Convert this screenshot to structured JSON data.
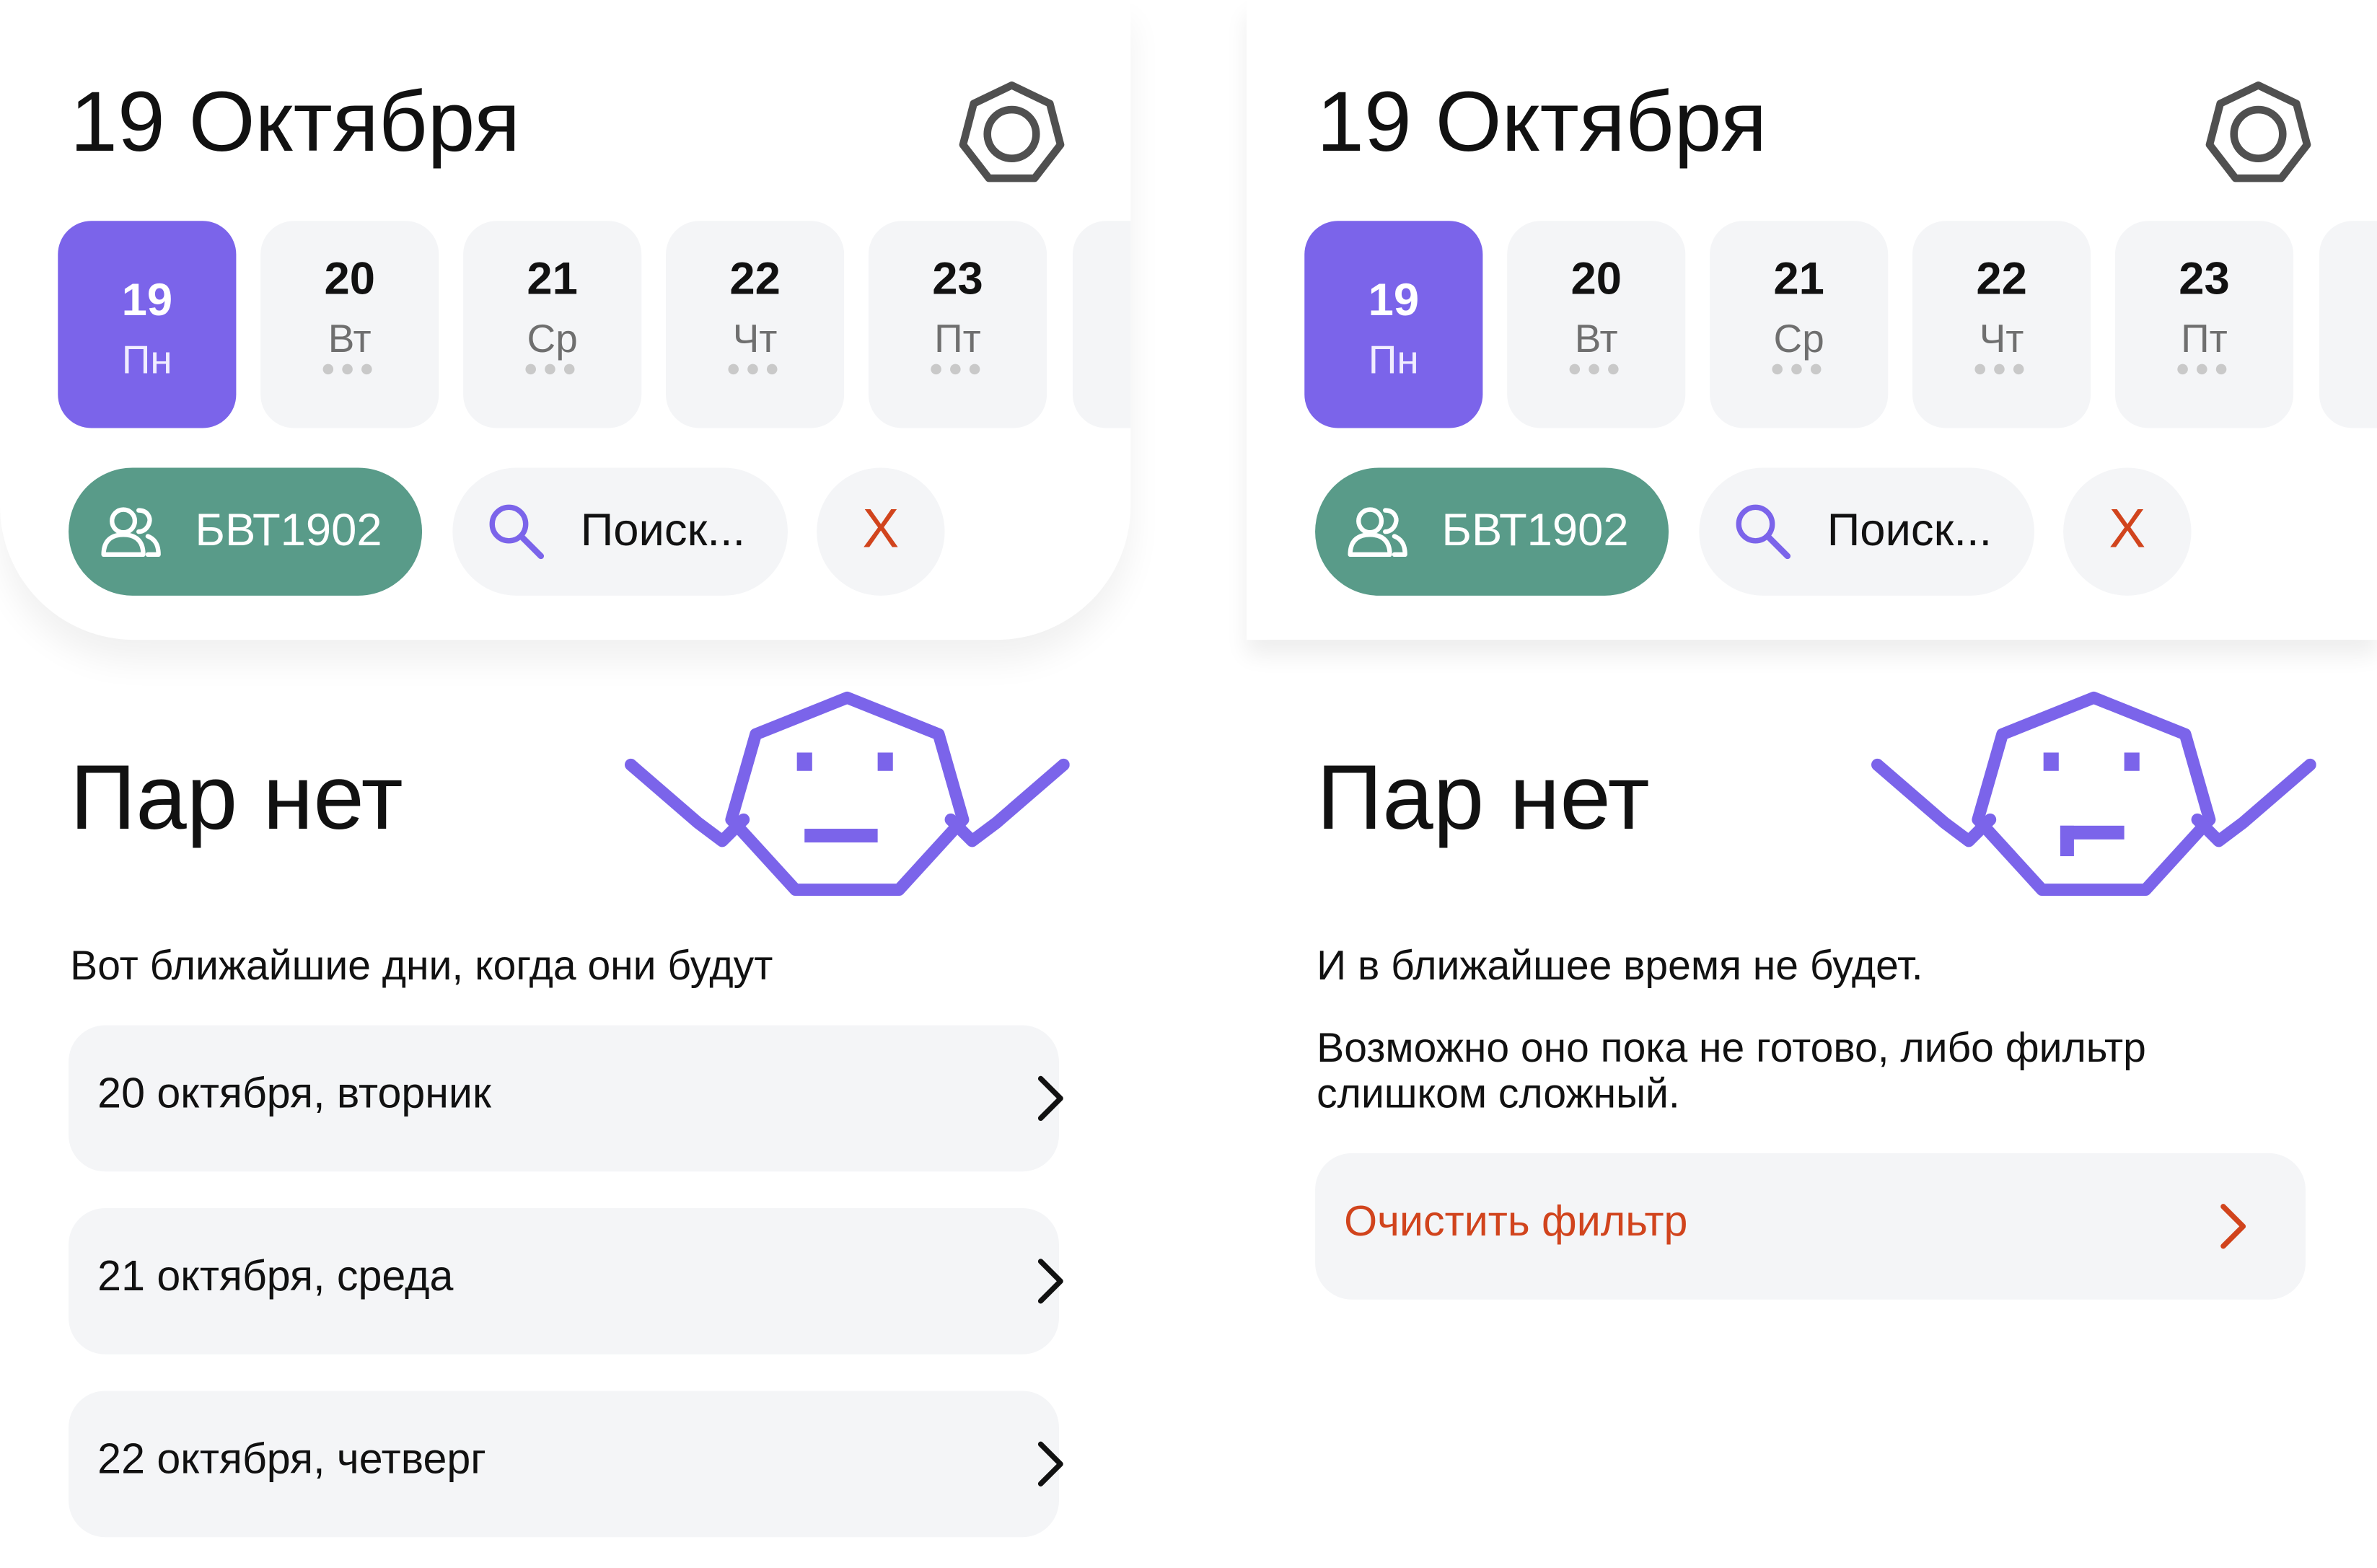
{
  "accent_color": "#7b64ea",
  "group_chip_color": "#599b89",
  "danger_color": "#d1441d",
  "screens": [
    {
      "header": {
        "date_title": "19 Октября",
        "settings_icon": "heptagon-settings-icon"
      },
      "days": [
        {
          "num": "19",
          "name": "Пн",
          "selected": true
        },
        {
          "num": "20",
          "name": "Вт",
          "dots": "●●●"
        },
        {
          "num": "21",
          "name": "Ср",
          "dots": "●●●"
        },
        {
          "num": "22",
          "name": "Чт",
          "dots": "●●●"
        },
        {
          "num": "23",
          "name": "Пт",
          "dots": "●●●"
        }
      ],
      "filters": {
        "group": {
          "icon": "people-icon",
          "label": "БВТ1902"
        },
        "search": {
          "icon": "search-icon",
          "label": "Поиск..."
        },
        "clear": {
          "label": "X"
        }
      },
      "empty": {
        "title": "Пар нет",
        "mascot": "neutral-face-icon",
        "subtitle": "Вот ближайшие дни, когда они будут",
        "next_days": [
          "20 октября, вторник",
          "21 октября, среда",
          "22 октября, четверг"
        ]
      }
    },
    {
      "header": {
        "date_title": "19 Октября",
        "settings_icon": "heptagon-settings-icon"
      },
      "days": [
        {
          "num": "19",
          "name": "Пн",
          "selected": true
        },
        {
          "num": "20",
          "name": "Вт",
          "dots": "●●●"
        },
        {
          "num": "21",
          "name": "Ср",
          "dots": "●●●"
        },
        {
          "num": "22",
          "name": "Чт",
          "dots": "●●●"
        },
        {
          "num": "23",
          "name": "Пт",
          "dots": "●●●"
        }
      ],
      "filters": {
        "group": {
          "icon": "people-icon",
          "label": "БВТ1902"
        },
        "search": {
          "icon": "search-icon",
          "label": "Поиск..."
        },
        "clear": {
          "label": "X"
        }
      },
      "empty": {
        "title": "Пар нет",
        "mascot": "confused-face-icon",
        "message": "И в ближайшее время не будет.",
        "hint_line1": "Возможно оно пока не готово, либо фильтр",
        "hint_line2": "слишком сложный.",
        "action_label": "Очистить фильтр"
      }
    }
  ]
}
